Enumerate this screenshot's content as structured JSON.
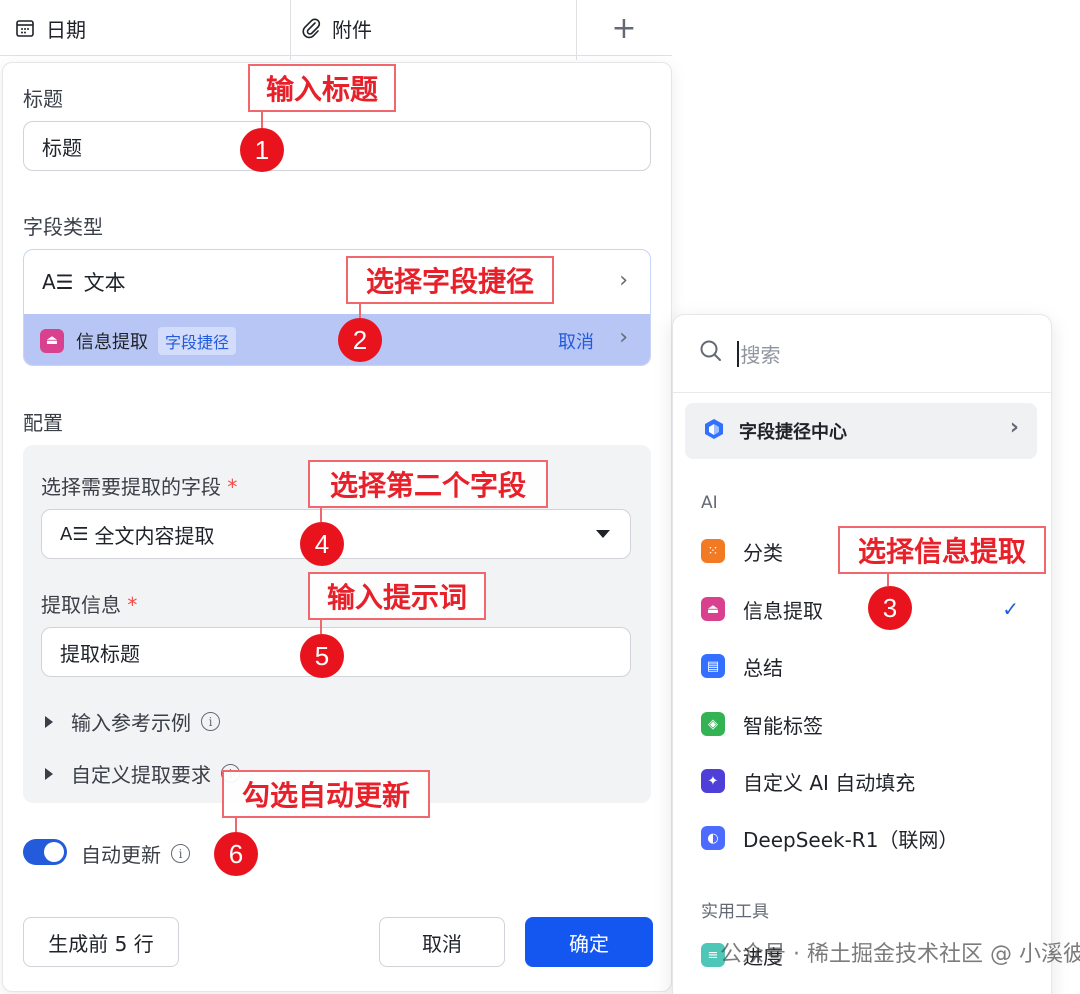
{
  "table_header": {
    "col_date": "日期",
    "col_attachment": "附件",
    "add_symbol": "+"
  },
  "form": {
    "title_label": "标题",
    "title_value": "标题",
    "field_type_label": "字段类型",
    "field_type_value": "文本",
    "shortcut_name": "信息提取",
    "shortcut_tag": "字段捷径",
    "shortcut_cancel": "取消",
    "config_label": "配置",
    "source_field_label": "选择需要提取的字段",
    "source_field_value": "全文内容提取",
    "extract_info_label": "提取信息",
    "extract_info_value": "提取标题",
    "required_mark": "*",
    "reference_examples": "输入参考示例",
    "custom_requirements": "自定义提取要求",
    "auto_update_label": "自动更新",
    "auto_update_on": true
  },
  "footer": {
    "generate_label": "生成前 5 行",
    "cancel_label": "取消",
    "confirm_label": "确定"
  },
  "popover": {
    "search_placeholder": "搜索",
    "center_label": "字段捷径中心",
    "section_ai": "AI",
    "ai_items": [
      "分类",
      "信息提取",
      "总结",
      "智能标签",
      "自定义 AI 自动填充",
      "DeepSeek-R1（联网）"
    ],
    "selected_item": "信息提取",
    "section_tools": "实用工具",
    "tools_item_partial": "进度"
  },
  "annotations": {
    "a1": "输入标题",
    "a2": "选择字段捷径",
    "a3": "选择信息提取",
    "a4": "选择第二个字段",
    "a5": "输入提示词",
    "a6": "勾选自动更新",
    "n1": "1",
    "n2": "2",
    "n3": "3",
    "n4": "4",
    "n5": "5",
    "n6": "6"
  },
  "watermark": "公众号 · 稀土掘金技术社区 @ 小溪彼岸",
  "colors": {
    "primary": "#1456f0",
    "shortcut_row": "#b8c6f5",
    "annotation_red": "#e8131c"
  }
}
